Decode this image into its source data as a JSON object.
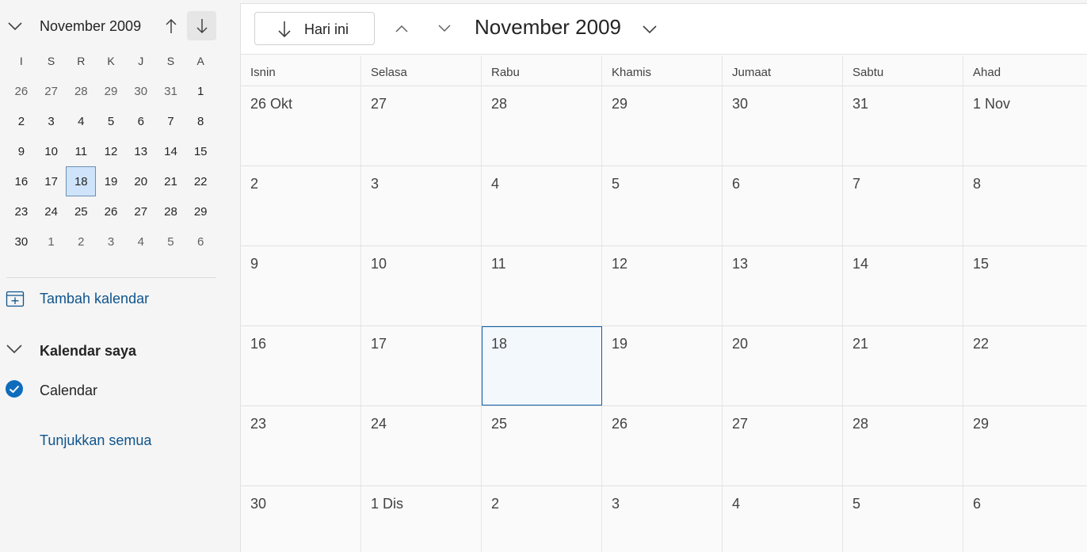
{
  "left": {
    "mini_title": "November 2009",
    "weekday_headers": [
      "I",
      "S",
      "R",
      "K",
      "J",
      "S",
      "A"
    ],
    "weeks": [
      [
        {
          "d": "26",
          "dim": true
        },
        {
          "d": "27",
          "dim": true
        },
        {
          "d": "28",
          "dim": true
        },
        {
          "d": "29",
          "dim": true
        },
        {
          "d": "30",
          "dim": true
        },
        {
          "d": "31",
          "dim": true
        },
        {
          "d": "1"
        }
      ],
      [
        {
          "d": "2"
        },
        {
          "d": "3"
        },
        {
          "d": "4"
        },
        {
          "d": "5"
        },
        {
          "d": "6"
        },
        {
          "d": "7"
        },
        {
          "d": "8"
        }
      ],
      [
        {
          "d": "9"
        },
        {
          "d": "10"
        },
        {
          "d": "11"
        },
        {
          "d": "12"
        },
        {
          "d": "13"
        },
        {
          "d": "14"
        },
        {
          "d": "15"
        }
      ],
      [
        {
          "d": "16"
        },
        {
          "d": "17"
        },
        {
          "d": "18",
          "sel": true
        },
        {
          "d": "19"
        },
        {
          "d": "20"
        },
        {
          "d": "21"
        },
        {
          "d": "22"
        }
      ],
      [
        {
          "d": "23"
        },
        {
          "d": "24"
        },
        {
          "d": "25"
        },
        {
          "d": "26"
        },
        {
          "d": "27"
        },
        {
          "d": "28"
        },
        {
          "d": "29"
        }
      ],
      [
        {
          "d": "30"
        },
        {
          "d": "1",
          "dim": true
        },
        {
          "d": "2",
          "dim": true
        },
        {
          "d": "3",
          "dim": true
        },
        {
          "d": "4",
          "dim": true
        },
        {
          "d": "5",
          "dim": true
        },
        {
          "d": "6",
          "dim": true
        }
      ]
    ],
    "add_calendar": "Tambah kalendar",
    "my_calendars": "Kalendar saya",
    "calendar_item": "Calendar",
    "show_all": "Tunjukkan semua"
  },
  "toolbar": {
    "today_label": "Hari ini",
    "title": "November 2009"
  },
  "month": {
    "day_headers": [
      "Isnin",
      "Selasa",
      "Rabu",
      "Khamis",
      "Jumaat",
      "Sabtu",
      "Ahad"
    ],
    "weeks": [
      [
        {
          "d": "26 Okt"
        },
        {
          "d": "27"
        },
        {
          "d": "28"
        },
        {
          "d": "29"
        },
        {
          "d": "30"
        },
        {
          "d": "31"
        },
        {
          "d": "1 Nov"
        }
      ],
      [
        {
          "d": "2"
        },
        {
          "d": "3"
        },
        {
          "d": "4"
        },
        {
          "d": "5"
        },
        {
          "d": "6"
        },
        {
          "d": "7"
        },
        {
          "d": "8"
        }
      ],
      [
        {
          "d": "9"
        },
        {
          "d": "10"
        },
        {
          "d": "11"
        },
        {
          "d": "12"
        },
        {
          "d": "13"
        },
        {
          "d": "14"
        },
        {
          "d": "15"
        }
      ],
      [
        {
          "d": "16"
        },
        {
          "d": "17"
        },
        {
          "d": "18",
          "today": true
        },
        {
          "d": "19"
        },
        {
          "d": "20"
        },
        {
          "d": "21"
        },
        {
          "d": "22"
        }
      ],
      [
        {
          "d": "23"
        },
        {
          "d": "24"
        },
        {
          "d": "25"
        },
        {
          "d": "26"
        },
        {
          "d": "27"
        },
        {
          "d": "28"
        },
        {
          "d": "29"
        }
      ],
      [
        {
          "d": "30"
        },
        {
          "d": "1 Dis"
        },
        {
          "d": "2"
        },
        {
          "d": "3"
        },
        {
          "d": "4"
        },
        {
          "d": "5"
        },
        {
          "d": "6"
        }
      ]
    ]
  },
  "colors": {
    "accent": "#0f6cbd",
    "link": "#0f548c",
    "selected_bg": "#cfe4fa",
    "today_border": "#115ea3"
  },
  "icons": {
    "collapse": "chevron-down-icon",
    "prev": "arrow-up-icon",
    "next": "arrow-down-icon",
    "add_calendar": "calendar-add-icon",
    "checked": "checkmark-circle-icon"
  }
}
